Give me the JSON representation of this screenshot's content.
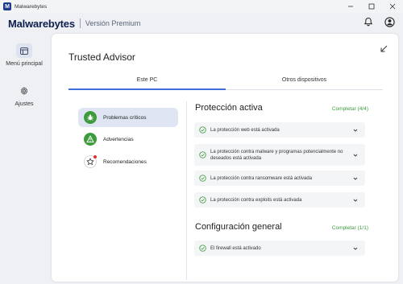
{
  "window": {
    "title": "Malwarebytes",
    "logo_letter": "M"
  },
  "header": {
    "brand": "Malwarebytes",
    "edition": "Versión Premium",
    "icons": [
      "bell-icon",
      "account-icon"
    ]
  },
  "sidebar": {
    "items": [
      {
        "label": "Menú principal",
        "icon": "dashboard-icon",
        "active": true
      },
      {
        "label": "Ajustes",
        "icon": "gear-icon",
        "active": false
      }
    ]
  },
  "main": {
    "title": "Trusted Advisor",
    "tabs": [
      {
        "label": "Este PC",
        "active": true
      },
      {
        "label": "Otros dispositivos",
        "active": false
      }
    ],
    "categories": [
      {
        "label": "Problemas críticos",
        "icon": "bug-icon",
        "active": true
      },
      {
        "label": "Advertencias",
        "icon": "warning-icon",
        "active": false
      },
      {
        "label": "Recomendaciones",
        "icon": "star-icon",
        "active": false
      }
    ],
    "sections": [
      {
        "title": "Protección activa",
        "status": "Completar (4/4)",
        "items": [
          "La protección web está activada",
          "La protección contra malware y programas potencialmente no deseados está activada",
          "La protección contra ransomware está activada",
          "La protección contra exploits está activada"
        ]
      },
      {
        "title": "Configuración general",
        "status": "Completar (1/1)",
        "items": [
          "El firewall está activado"
        ]
      }
    ]
  },
  "colors": {
    "accent": "#3f6fd8",
    "success": "#3d9a3d",
    "brand": "#0d1f4d",
    "warning": "#3d9a3d"
  }
}
